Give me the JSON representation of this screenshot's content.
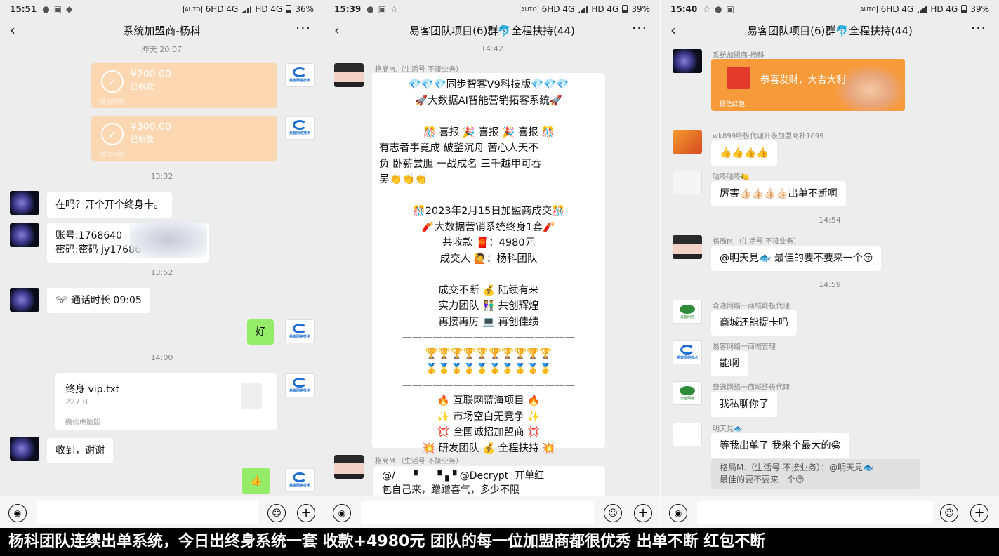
{
  "panel1": {
    "status": {
      "time": "15:51",
      "net": "6HD 4G",
      "hd": "HD 4G",
      "battery": "36%"
    },
    "title": "系统加盟商-杨科",
    "ts1": "昨天 20:07",
    "transfer1": {
      "amount": "¥200.00",
      "status": "已收款",
      "source": "微信转账"
    },
    "transfer2": {
      "amount": "¥300.00",
      "status": "已收款",
      "source": "微信转账"
    },
    "ts2": "13:32",
    "msg1": "在吗？开个开个终身卡。",
    "msg2a": "账号:1768640",
    "msg2b": "密码:密码 jy17686",
    "ts3": "13:52",
    "call": "通话时长 09:05",
    "reply_ok": "好",
    "ts4": "14:00",
    "file": {
      "name": "终身 vip.txt",
      "size": "227 B",
      "source": "微信电脑版"
    },
    "msg3": "收到，谢谢",
    "thumb": "👍",
    "logo_text": "易客网络技术"
  },
  "panel2": {
    "status": {
      "time": "15:39",
      "net": "6HD 4G",
      "hd": "HD 4G",
      "battery": "39%"
    },
    "title": "易客团队项目(6)群🐬全程扶持(44)",
    "ts1": "14:42",
    "nick1": "格局M.（生活号 不接业务）",
    "post": [
      "💎💎💎同步智客V9科技版💎💎💎",
      "🚀大数据AI智能营销拓客系统🚀",
      "",
      "🎊 喜报 🎉 喜报 🎉 喜报 🎊",
      "有志者事竟成 破釜沉舟 苦心人天不",
      "负 卧薪尝胆 一战成名 三千越甲可吞",
      "吴👏👏👏",
      "",
      "🎊2023年2月15日加盟商成交🎊",
      "🧨大数据营销系统终身1套🧨",
      "共收款 🧧：4980元",
      "成交人 🙋：杨科团队",
      "",
      "成交不断 💰 陆续有来",
      "实力团队 👫 共创辉煌",
      "再接再厉 💻 再创佳绩",
      "—————————————————",
      "🏆🏆🏆🏆🏆🏆🏆🏆🏆🏆",
      "🥇🥇🥇🥇🥇🥇🥇🥇🥇🥇",
      "—————————————————",
      "🔥 互联网蓝海项目 🔥",
      "✨ 市场空白无竞争 ✨",
      "💢 全国诚招加盟商 💢",
      "💥 研发团队 💰 全程扶持 💥"
    ],
    "nick2": "格局M.（生活号 不接业务）",
    "msg2a": "@/      ▘    ▝▗▝ @Decrypt  开单红",
    "msg2b": "包自己来，蹭蹭喜气，多少不限"
  },
  "panel3": {
    "status": {
      "time": "15:40",
      "net": "6HD 4G",
      "hd": "HD 4G",
      "battery": "39%"
    },
    "title": "易客团队项目(6)群🐬全程扶持(44)",
    "nick1": "系统加盟商-杨科",
    "redpack": {
      "message": "恭喜发财，大吉大利",
      "label": "微信红包"
    },
    "nick2": "wk899终极代理升级加盟商补1699",
    "msg2": "👍👍👍👍",
    "nick3": "咕咚咕咚🍋",
    "msg3": "厉害👍🏻👍🏻👍🏻👍🏻出单不断啊",
    "ts1": "14:54",
    "nick4": "格局M.（生活号 不接业务）",
    "msg4": "@明天見🐟 最佳的要不要来一个😚",
    "ts2": "14:59",
    "nick5": "奇逸网络一商城终极代理",
    "msg5": "商城还能提卡吗",
    "nick6": "易客网络一商城管理",
    "msg6": "能啊",
    "nick7": "奇逸网络一商城终极代理",
    "msg7": "我私聊你了",
    "nick8": "明天見🐟",
    "msg8": "等我出单了 我来个最大的😁",
    "quote_a": "格局M.（生活号 不接业务）：@明天見🐟",
    "quote_b": "最佳的要不要来一个😚",
    "green_logo": "云客网络"
  },
  "caption": "杨科团队连续出单系统，今日出终身系统一套  收款+4980元  团队的每一位加盟商都很优秀  出单不断  红包不断"
}
